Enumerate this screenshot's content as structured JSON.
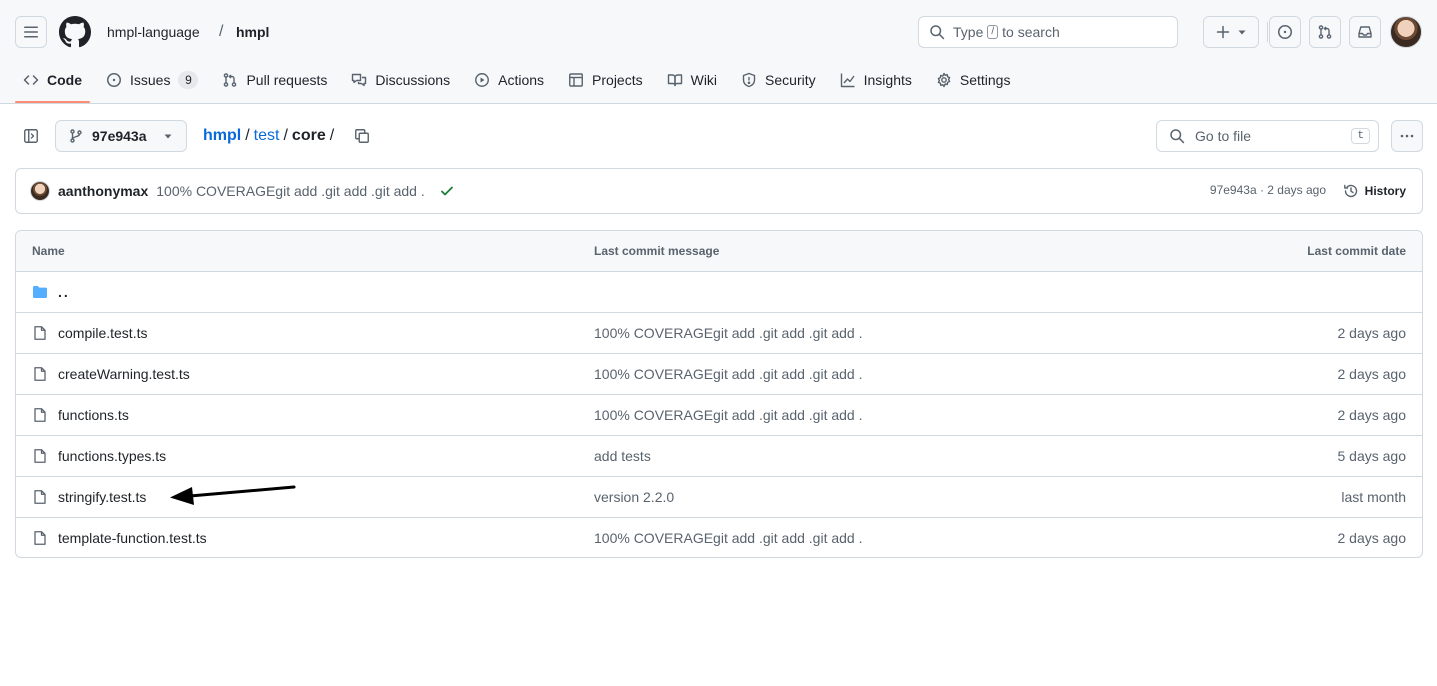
{
  "header": {
    "owner": "hmpl-language",
    "slash": "/",
    "repo": "hmpl",
    "search": {
      "prefix": "Type",
      "key": "/",
      "suffix": "to search"
    }
  },
  "tabs": [
    {
      "label": "Code",
      "icon": "code-icon",
      "active": true
    },
    {
      "label": "Issues",
      "icon": "issue-opened-icon",
      "count": "9"
    },
    {
      "label": "Pull requests",
      "icon": "git-pull-request-icon"
    },
    {
      "label": "Discussions",
      "icon": "comment-discussion-icon"
    },
    {
      "label": "Actions",
      "icon": "play-icon"
    },
    {
      "label": "Projects",
      "icon": "table-icon"
    },
    {
      "label": "Wiki",
      "icon": "book-icon"
    },
    {
      "label": "Security",
      "icon": "shield-icon"
    },
    {
      "label": "Insights",
      "icon": "graph-icon"
    },
    {
      "label": "Settings",
      "icon": "gear-icon"
    }
  ],
  "toolbar": {
    "branch": "97e943a",
    "breadcrumb": {
      "root": "hmpl",
      "sep1": "/",
      "dir": "test",
      "sep2": "/",
      "current": "core",
      "sep3": "/"
    },
    "goto_placeholder": "Go to file",
    "goto_key": "t"
  },
  "commit": {
    "author": "aanthonymax",
    "message": "100% COVERAGEgit add .git add .git add .",
    "meta": "97e943a · 2 days ago",
    "history_label": "History"
  },
  "table": {
    "headers": {
      "name": "Name",
      "message": "Last commit message",
      "date": "Last commit date"
    },
    "parent": "..",
    "files": [
      {
        "name": "compile.test.ts",
        "message": "100% COVERAGEgit add .git add .git add .",
        "date": "2 days ago"
      },
      {
        "name": "createWarning.test.ts",
        "message": "100% COVERAGEgit add .git add .git add .",
        "date": "2 days ago"
      },
      {
        "name": "functions.ts",
        "message": "100% COVERAGEgit add .git add .git add .",
        "date": "2 days ago"
      },
      {
        "name": "functions.types.ts",
        "message": "add tests",
        "date": "5 days ago"
      },
      {
        "name": "stringify.test.ts",
        "message": "version 2.2.0",
        "date": "last month"
      },
      {
        "name": "template-function.test.ts",
        "message": "100% COVERAGEgit add .git add .git add .",
        "date": "2 days ago"
      }
    ]
  },
  "colors": {
    "link": "#0969da",
    "active_tab_underline": "#fd8c73",
    "success": "#1a7f37",
    "folder": "#54aeff"
  }
}
